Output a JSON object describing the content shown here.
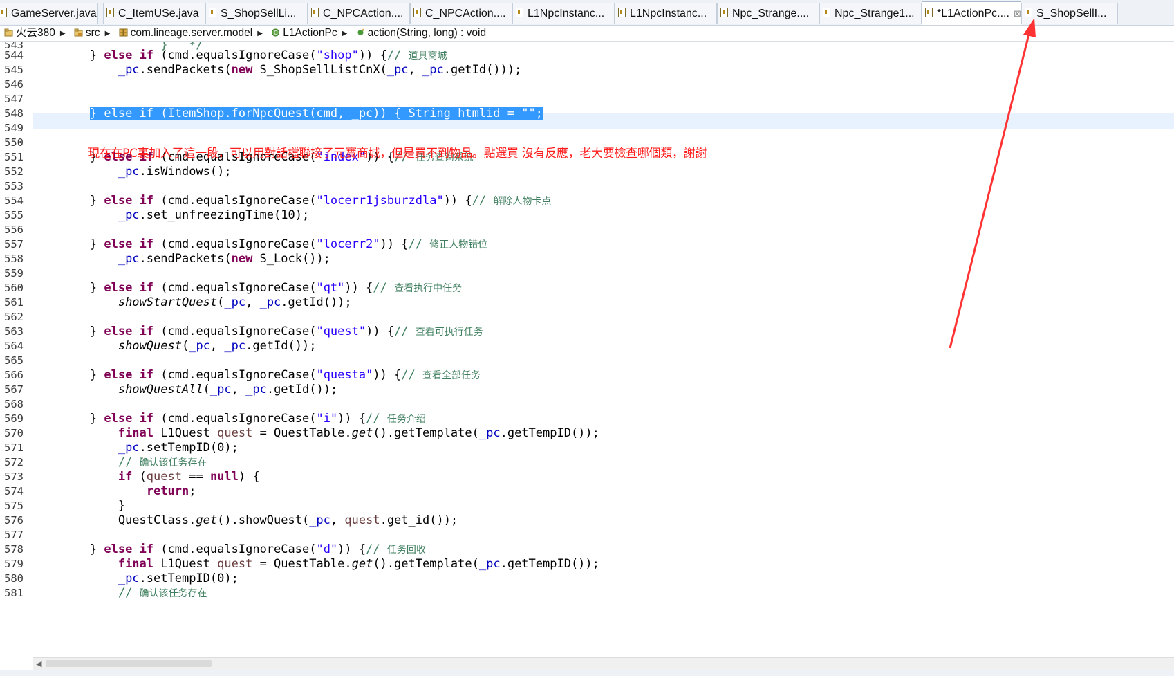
{
  "tabs": [
    {
      "label": "GameServer.java"
    },
    {
      "label": "C_ItemUSe.java"
    },
    {
      "label": "S_ShopSellLi..."
    },
    {
      "label": "C_NPCAction...."
    },
    {
      "label": "C_NPCAction...."
    },
    {
      "label": "L1NpcInstanc..."
    },
    {
      "label": "L1NpcInstanc..."
    },
    {
      "label": "Npc_Strange...."
    },
    {
      "label": "Npc_Strange1..."
    },
    {
      "label": "*L1ActionPc....",
      "active": true,
      "close": "⊠"
    },
    {
      "label": "S_ShopSellI..."
    }
  ],
  "breadcrumb": [
    {
      "label": "火云380",
      "icon": "project-icon"
    },
    {
      "label": "src",
      "icon": "source-folder-icon"
    },
    {
      "label": "com.lineage.server.model",
      "icon": "package-icon"
    },
    {
      "label": "L1ActionPc",
      "icon": "class-icon"
    },
    {
      "label": "action(String, long) : void",
      "icon": "method-icon"
    }
  ],
  "editor": {
    "current_line": "550",
    "line_numbers": [
      "543",
      "544",
      "545",
      "546",
      "547",
      "548",
      "549",
      "550",
      "551",
      "552",
      "553",
      "554",
      "555",
      "556",
      "557",
      "558",
      "559",
      "560",
      "561",
      "562",
      "563",
      "564",
      "565",
      "566",
      "567",
      "568",
      "569",
      "570",
      "571",
      "572",
      "573",
      "574",
      "575",
      "576",
      "577",
      "578",
      "579",
      "580",
      "581"
    ],
    "lines": {
      "l543": "                  }   */",
      "l544_a": "        } ",
      "l544_kw1": "else",
      "l544_b": " ",
      "l544_kw2": "if",
      "l544_c": " (cmd.equalsIgnoreCase(",
      "l544_str": "\"shop\"",
      "l544_d": ")) {",
      "l544_cmt": "// ",
      "l544_cn": "道具商城",
      "l545_a": "            ",
      "l545_fld": "_pc",
      "l545_b": ".sendPackets(",
      "l545_kw": "new",
      "l545_c": " S_ShopSellListCnX(",
      "l545_fld2": "_pc",
      "l545_d": ", ",
      "l545_fld3": "_pc",
      "l545_e": ".getId()));",
      "l548_indent": "        ",
      "l548_hl": "} else if (ItemShop.forNpcQuest(cmd, _pc)) { String htmlid = \"\";",
      "l551_a": "        } ",
      "l551_kw1": "else",
      "l551_kw2": "if",
      "l551_c": " (cmd.equalsIgnoreCase(",
      "l551_str": "\"index\"",
      "l551_d": ")) {",
      "l551_cmt": "// ",
      "l551_cn": "任务查询系统",
      "l552_fld": "_pc",
      "l552_b": ".isWindows();",
      "l554_str": "\"locerr1jsburzdla\"",
      "l554_cn": "解除人物卡点",
      "l555_fld": "_pc",
      "l555_b": ".set_unfreezingTime(10);",
      "l557_str": "\"locerr2\"",
      "l557_cn": "修正人物错位",
      "l558_fld": "_pc",
      "l558_b": ".sendPackets(",
      "l558_kw": "new",
      "l558_c": " S_Lock());",
      "l560_str": "\"qt\"",
      "l560_cn": "查看执行中任务",
      "l561_it": "showStartQuest",
      "l561_b": "(",
      "l561_fld": "_pc",
      "l561_c": ", ",
      "l561_fld2": "_pc",
      "l561_d": ".getId());",
      "l563_str": "\"quest\"",
      "l563_cn": "查看可执行任务",
      "l564_it": "showQuest",
      "l566_str": "\"questa\"",
      "l566_cn": "查看全部任务",
      "l567_it": "showQuestAll",
      "l569_str": "\"i\"",
      "l569_cn": "任务介绍",
      "l570_kw": "final",
      "l570_b": " L1Quest ",
      "l570_var": "quest",
      "l570_c": " = QuestTable.",
      "l570_it": "get",
      "l570_d": "().getTemplate(",
      "l570_fld": "_pc",
      "l570_e": ".getTempID());",
      "l571_fld": "_pc",
      "l571_b": ".setTempID(0);",
      "l572_cmt": "// ",
      "l572_cn": "确认该任务存在",
      "l573_kw": "if",
      "l573_b": " (",
      "l573_var": "quest",
      "l573_c": " == ",
      "l573_kw2": "null",
      "l573_d": ") {",
      "l574_kw": "return",
      "l574_b": ";",
      "l575": "            }",
      "l576_a": "            QuestClass.",
      "l576_it": "get",
      "l576_b": "().showQuest(",
      "l576_fld": "_pc",
      "l576_c": ", ",
      "l576_var": "quest",
      "l576_d": ".get_id());",
      "l578_str": "\"d\"",
      "l578_cn": "任务回收"
    },
    "common": {
      "else": "else",
      "if": "if",
      "eic": " (cmd.equalsIgnoreCase(",
      "close_paren": ")) {",
      "cmt": "// ",
      "brace_indent": "        } ",
      "space": " ",
      "indent": "            ",
      "pc": "_pc",
      "comma": ", ",
      "getid_end": ".getId());",
      "open": "("
    }
  },
  "annotation": {
    "text": "現在在PC裏加入了這一段，可以用對話檔聯接了元寶商城，但是買不到物品。點選買 沒有反應，老大要檢查哪個類，謝謝",
    "color": "#ff1c1c"
  },
  "colors": {
    "keyword": "#7f0055",
    "string": "#2a00ff",
    "field": "#0000c0",
    "comment": "#3f7f5f",
    "selection": "#3399ff",
    "annotation_arrow": "#ff3333"
  }
}
